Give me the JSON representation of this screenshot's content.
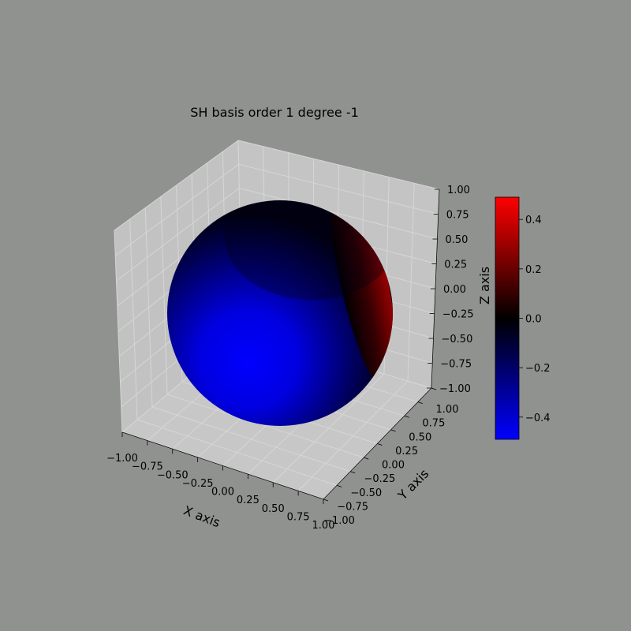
{
  "figure": {
    "background": "#909290",
    "pane_color": "#c2c2c2",
    "grid_color": "#d3d3d3"
  },
  "chart_data": {
    "type": "surface",
    "title": "SH basis order 1 degree -1",
    "xlabel": "X axis",
    "ylabel": "Y axis",
    "zlabel": "Z axis",
    "xlim": [
      -1,
      1
    ],
    "ylim": [
      -1,
      1
    ],
    "zlim": [
      -1,
      1
    ],
    "grid": true,
    "surface": "unit sphere colored by real spherical harmonic order 1 degree -1",
    "x_ticks": [
      "−1.00",
      "−0.75",
      "−0.50",
      "−0.25",
      "0.00",
      "0.25",
      "0.50",
      "0.75",
      "1.00"
    ],
    "y_ticks": [
      "−1.00",
      "−0.75",
      "−0.50",
      "−0.25",
      "0.00",
      "0.25",
      "0.50",
      "0.75",
      "1.00"
    ],
    "z_ticks": [
      "−1.00",
      "−0.75",
      "−0.50",
      "−0.25",
      "0.00",
      "0.25",
      "0.50",
      "0.75",
      "1.00"
    ],
    "colorbar": {
      "range": [
        -0.49,
        0.49
      ],
      "colors": [
        "#0000ff",
        "#000000",
        "#ff0000"
      ],
      "ticks": [
        "−0.4",
        "−0.2",
        "0.0",
        "0.2",
        "0.4"
      ],
      "tick_values": [
        -0.4,
        -0.2,
        0.0,
        0.2,
        0.4
      ]
    }
  }
}
